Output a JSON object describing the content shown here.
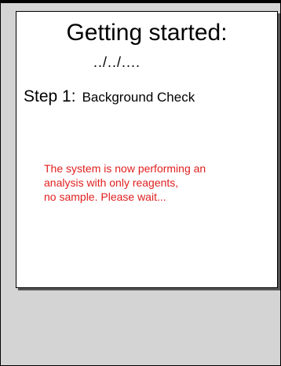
{
  "title": "Getting started:",
  "date": "../../....",
  "step": {
    "label": "Step 1:",
    "name": "Background Check"
  },
  "message": {
    "lines": [
      "The system is now performing an",
      "analysis with only reagents,",
      "no sample.  Please wait..."
    ],
    "color": "#e02020"
  }
}
